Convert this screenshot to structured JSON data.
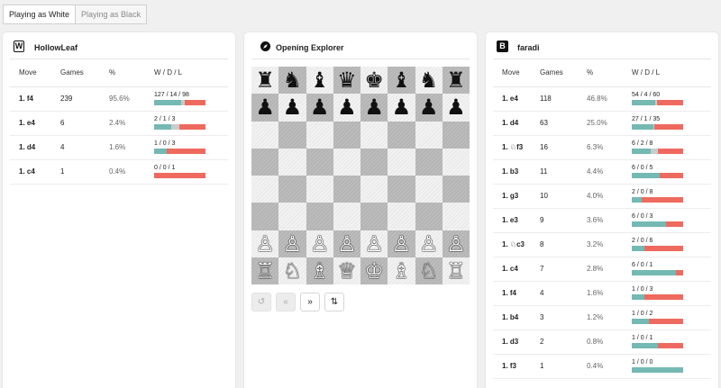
{
  "tabs": [
    "Playing as White",
    "Playing as Black"
  ],
  "left": {
    "badge": "W",
    "name": "HollowLeaf",
    "headers": [
      "Move",
      "Games",
      "%",
      "W / D / L"
    ],
    "rows": [
      {
        "move": "1. f4",
        "games": "239",
        "pct": "95.6%",
        "wdl": "127 / 14 / 98",
        "w": 127,
        "d": 14,
        "l": 98
      },
      {
        "move": "1. e4",
        "games": "6",
        "pct": "2.4%",
        "wdl": "2 / 1 / 3",
        "w": 2,
        "d": 1,
        "l": 3
      },
      {
        "move": "1. d4",
        "games": "4",
        "pct": "1.6%",
        "wdl": "1 / 0 / 3",
        "w": 1,
        "d": 0,
        "l": 3
      },
      {
        "move": "1. c4",
        "games": "1",
        "pct": "0.4%",
        "wdl": "0 / 0 / 1",
        "w": 0,
        "d": 0,
        "l": 1
      }
    ]
  },
  "middle": {
    "title": "Opening Explorer",
    "icon": "compass-icon",
    "board": [
      [
        "♜",
        "♞",
        "♝",
        "♛",
        "♚",
        "♝",
        "♞",
        "♜"
      ],
      [
        "♟",
        "♟",
        "♟",
        "♟",
        "♟",
        "♟",
        "♟",
        "♟"
      ],
      [
        "",
        "",
        "",
        "",
        "",
        "",
        "",
        ""
      ],
      [
        "",
        "",
        "",
        "",
        "",
        "",
        "",
        ""
      ],
      [
        "",
        "",
        "",
        "",
        "",
        "",
        "",
        ""
      ],
      [
        "",
        "",
        "",
        "",
        "",
        "",
        "",
        ""
      ],
      [
        "♙",
        "♙",
        "♙",
        "♙",
        "♙",
        "♙",
        "♙",
        "♙"
      ],
      [
        "♖",
        "♘",
        "♗",
        "♕",
        "♔",
        "♗",
        "♘",
        "♖"
      ]
    ],
    "controls": [
      {
        "name": "undo-button",
        "icon": "↺",
        "disabled": true
      },
      {
        "name": "back-button",
        "icon": "«",
        "disabled": true
      },
      {
        "name": "forward-button",
        "icon": "»",
        "disabled": false
      },
      {
        "name": "flip-board-button",
        "icon": "⇅",
        "disabled": false
      }
    ]
  },
  "right": {
    "badge": "B",
    "name": "faradi",
    "headers": [
      "Move",
      "Games",
      "%",
      "W / D / L"
    ],
    "rows": [
      {
        "move": "1. e4",
        "games": "118",
        "pct": "46.8%",
        "wdl": "54 / 4 / 60",
        "w": 54,
        "d": 4,
        "l": 60
      },
      {
        "move": "1. d4",
        "games": "63",
        "pct": "25.0%",
        "wdl": "27 / 1 / 35",
        "w": 27,
        "d": 1,
        "l": 35
      },
      {
        "move": "1. ♘f3",
        "games": "16",
        "pct": "6.3%",
        "wdl": "6 / 2 / 8",
        "w": 6,
        "d": 2,
        "l": 8
      },
      {
        "move": "1. b3",
        "games": "11",
        "pct": "4.4%",
        "wdl": "6 / 0 / 5",
        "w": 6,
        "d": 0,
        "l": 5
      },
      {
        "move": "1. g3",
        "games": "10",
        "pct": "4.0%",
        "wdl": "2 / 0 / 8",
        "w": 2,
        "d": 0,
        "l": 8
      },
      {
        "move": "1. e3",
        "games": "9",
        "pct": "3.6%",
        "wdl": "6 / 0 / 3",
        "w": 6,
        "d": 0,
        "l": 3
      },
      {
        "move": "1. ♘c3",
        "games": "8",
        "pct": "3.2%",
        "wdl": "2 / 0 / 6",
        "w": 2,
        "d": 0,
        "l": 6
      },
      {
        "move": "1. c4",
        "games": "7",
        "pct": "2.8%",
        "wdl": "6 / 0 / 1",
        "w": 6,
        "d": 0,
        "l": 1
      },
      {
        "move": "1. f4",
        "games": "4",
        "pct": "1.6%",
        "wdl": "1 / 0 / 3",
        "w": 1,
        "d": 0,
        "l": 3
      },
      {
        "move": "1. b4",
        "games": "3",
        "pct": "1.2%",
        "wdl": "1 / 0 / 2",
        "w": 1,
        "d": 0,
        "l": 2
      },
      {
        "move": "1. d3",
        "games": "2",
        "pct": "0.8%",
        "wdl": "1 / 0 / 1",
        "w": 1,
        "d": 0,
        "l": 1
      },
      {
        "move": "1. f3",
        "games": "1",
        "pct": "0.4%",
        "wdl": "1 / 0 / 0",
        "w": 1,
        "d": 0,
        "l": 0
      }
    ]
  },
  "colors": {
    "win": "#74b9b3",
    "draw": "#c9cccc",
    "loss": "#ef6a5e"
  }
}
